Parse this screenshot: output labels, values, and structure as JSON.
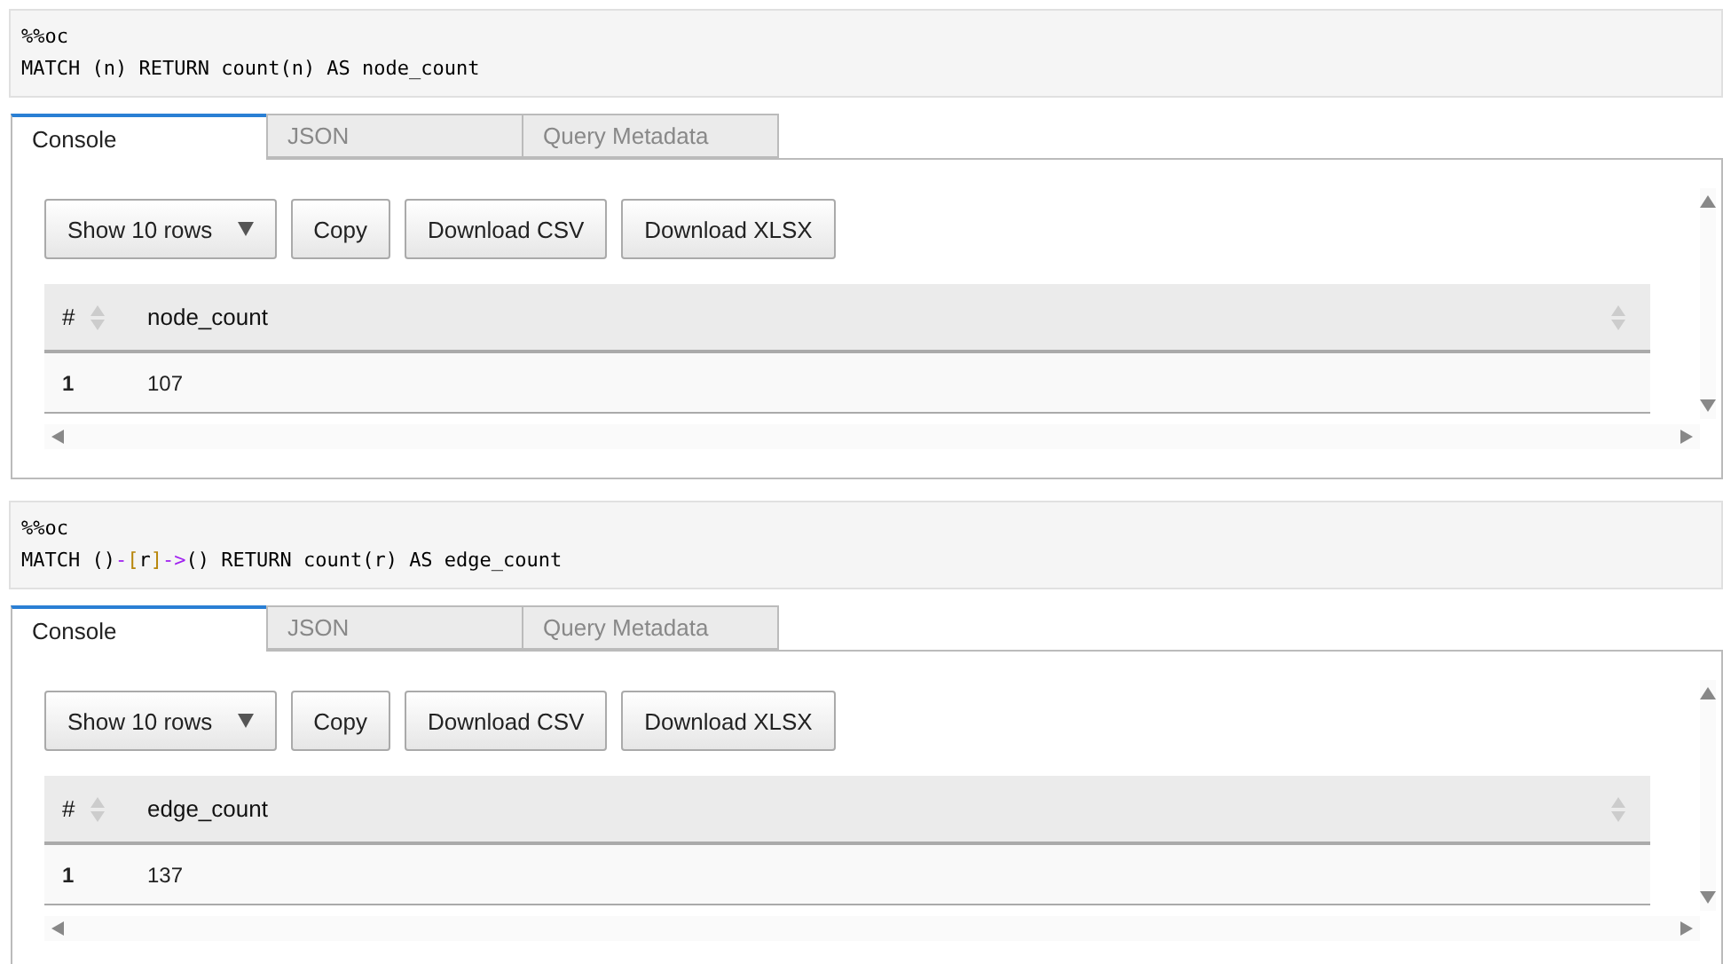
{
  "cells": [
    {
      "code": {
        "magic": "%%oc",
        "tokens": [
          {
            "kind": "plain",
            "text": "MATCH (n) RETURN count(n) AS node_count"
          }
        ]
      },
      "tabs": [
        {
          "label": "Console",
          "selected": true
        },
        {
          "label": "JSON",
          "selected": false
        },
        {
          "label": "Query Metadata",
          "selected": false
        }
      ],
      "page_length": "Show 10 rows",
      "buttons": [
        "Copy",
        "Download CSV",
        "Download XLSX"
      ],
      "table": {
        "columns": [
          "#",
          "node_count"
        ],
        "rows": [
          [
            "1",
            "107"
          ]
        ]
      }
    },
    {
      "code": {
        "magic": "%%oc",
        "tokens": [
          {
            "kind": "plain",
            "text": "MATCH ()"
          },
          {
            "kind": "operator",
            "text": "-"
          },
          {
            "kind": "bracket",
            "text": "["
          },
          {
            "kind": "plain",
            "text": "r"
          },
          {
            "kind": "bracket",
            "text": "]"
          },
          {
            "kind": "operator",
            "text": "->"
          },
          {
            "kind": "plain",
            "text": "() RETURN count(r) AS edge_count"
          }
        ]
      },
      "tabs": [
        {
          "label": "Console",
          "selected": true
        },
        {
          "label": "JSON",
          "selected": false
        },
        {
          "label": "Query Metadata",
          "selected": false
        }
      ],
      "page_length": "Show 10 rows",
      "buttons": [
        "Copy",
        "Download CSV",
        "Download XLSX"
      ],
      "table": {
        "columns": [
          "#",
          "edge_count"
        ],
        "rows": [
          [
            "1",
            "137"
          ]
        ]
      }
    }
  ]
}
